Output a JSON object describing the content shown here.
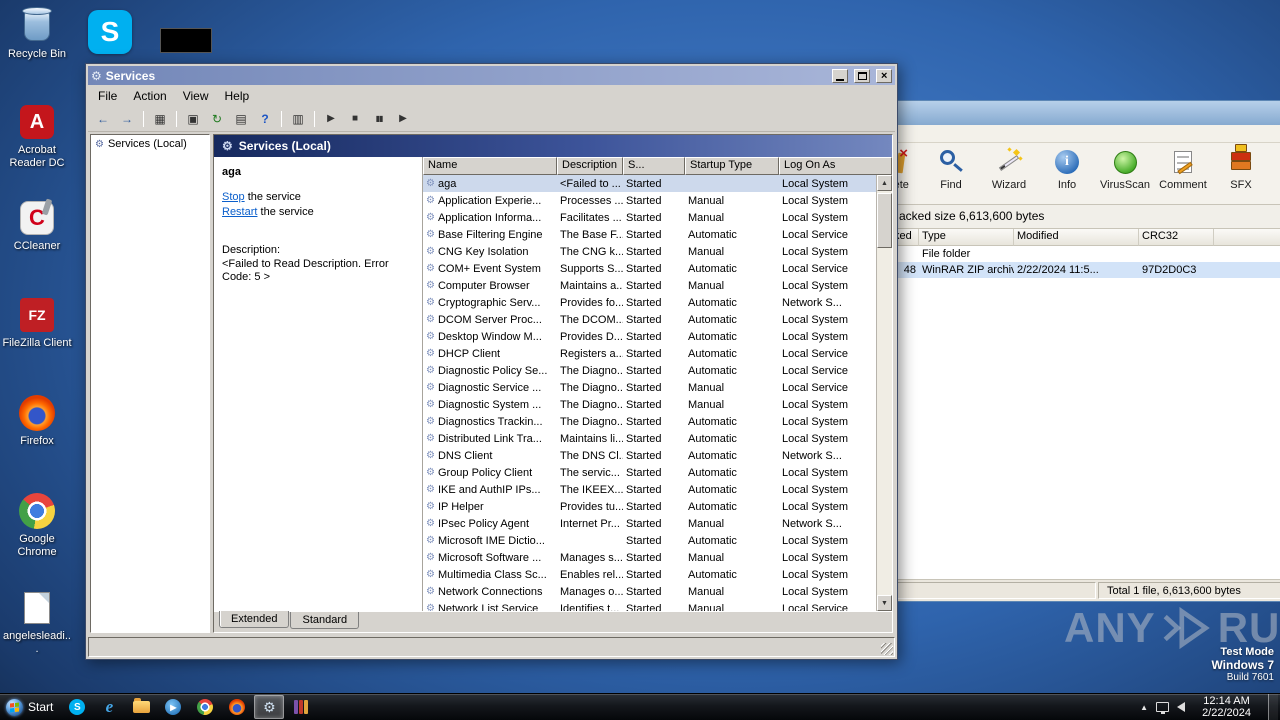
{
  "desktop": {
    "icons": [
      {
        "label": "Recycle Bin"
      },
      {
        "label": "Acrobat Reader DC"
      },
      {
        "label": "CCleaner"
      },
      {
        "label": "FileZilla Client"
      },
      {
        "label": "Firefox"
      },
      {
        "label": "Google Chrome"
      },
      {
        "label": "angelesleadi..."
      }
    ]
  },
  "icons": {
    "back": "←",
    "forward": "→",
    "tree": "▦",
    "window": "▣",
    "refresh": "↻",
    "export": "▤",
    "help": "?",
    "list": "▥",
    "start": "▶",
    "stop": "■",
    "pause": "▮▮",
    "restart": "▶",
    "gear": "⚙",
    "skype_letter": "S",
    "acrobat_letter": "A",
    "ccleaner_letter": "C",
    "filezilla_letters": "FZ",
    "ie_letter": "e",
    "wmp_glyph": "▶"
  },
  "services": {
    "title": "Services",
    "menu": [
      "File",
      "Action",
      "View",
      "Help"
    ],
    "tree_root": "Services (Local)",
    "band_title": "Services (Local)",
    "detail": {
      "service_name": "aga",
      "stop_link": "Stop",
      "stop_suffix": " the service",
      "restart_link": "Restart",
      "restart_suffix": " the service",
      "description_label": "Description:",
      "description": "<Failed to Read Description. Error Code: 5 >"
    },
    "columns": [
      "Name",
      "Description",
      "S...",
      "Startup Type",
      "Log On As"
    ],
    "rows": [
      [
        "aga",
        "<Failed to ...",
        "Started",
        "",
        "Local System"
      ],
      [
        "Application Experie...",
        "Processes ...",
        "Started",
        "Manual",
        "Local System"
      ],
      [
        "Application Informa...",
        "Facilitates ...",
        "Started",
        "Manual",
        "Local System"
      ],
      [
        "Base Filtering Engine",
        "The Base F...",
        "Started",
        "Automatic",
        "Local Service"
      ],
      [
        "CNG Key Isolation",
        "The CNG k...",
        "Started",
        "Manual",
        "Local System"
      ],
      [
        "COM+ Event System",
        "Supports S...",
        "Started",
        "Automatic",
        "Local Service"
      ],
      [
        "Computer Browser",
        "Maintains a...",
        "Started",
        "Manual",
        "Local System"
      ],
      [
        "Cryptographic Serv...",
        "Provides fo...",
        "Started",
        "Automatic",
        "Network S..."
      ],
      [
        "DCOM Server Proc...",
        "The DCOM...",
        "Started",
        "Automatic",
        "Local System"
      ],
      [
        "Desktop Window M...",
        "Provides D...",
        "Started",
        "Automatic",
        "Local System"
      ],
      [
        "DHCP Client",
        "Registers a...",
        "Started",
        "Automatic",
        "Local Service"
      ],
      [
        "Diagnostic Policy Se...",
        "The Diagno...",
        "Started",
        "Automatic",
        "Local Service"
      ],
      [
        "Diagnostic Service ...",
        "The Diagno...",
        "Started",
        "Manual",
        "Local Service"
      ],
      [
        "Diagnostic System ...",
        "The Diagno...",
        "Started",
        "Manual",
        "Local System"
      ],
      [
        "Diagnostics Trackin...",
        "The Diagno...",
        "Started",
        "Automatic",
        "Local System"
      ],
      [
        "Distributed Link Tra...",
        "Maintains li...",
        "Started",
        "Automatic",
        "Local System"
      ],
      [
        "DNS Client",
        "The DNS Cl...",
        "Started",
        "Automatic",
        "Network S..."
      ],
      [
        "Group Policy Client",
        "The servic...",
        "Started",
        "Automatic",
        "Local System"
      ],
      [
        "IKE and AuthIP IPs...",
        "The IKEEX...",
        "Started",
        "Automatic",
        "Local System"
      ],
      [
        "IP Helper",
        "Provides tu...",
        "Started",
        "Automatic",
        "Local System"
      ],
      [
        "IPsec Policy Agent",
        "Internet Pr...",
        "Started",
        "Manual",
        "Network S..."
      ],
      [
        "Microsoft IME Dictio...",
        "",
        "Started",
        "Automatic",
        "Local System"
      ],
      [
        "Microsoft Software ...",
        "Manages s...",
        "Started",
        "Manual",
        "Local System"
      ],
      [
        "Multimedia Class Sc...",
        "Enables rel...",
        "Started",
        "Automatic",
        "Local System"
      ],
      [
        "Network Connections",
        "Manages o...",
        "Started",
        "Manual",
        "Local System"
      ],
      [
        "Network List Service",
        "Identifies t...",
        "Started",
        "Manual",
        "Local Service"
      ]
    ],
    "tabs": [
      "Extended",
      "Standard"
    ]
  },
  "winrar": {
    "toolbar": [
      "Delete",
      "Find",
      "Wizard",
      "Info",
      "VirusScan",
      "Comment",
      "SFX"
    ],
    "info_bar": "acked size  6,613,600 bytes",
    "columns": [
      "Packed",
      "Type",
      "Modified",
      "CRC32"
    ],
    "rows": [
      [
        "",
        "File folder",
        "",
        ""
      ],
      [
        "48",
        "WinRAR ZIP archive",
        "2/22/2024 11:5...",
        "97D2D0C3"
      ]
    ],
    "status_total": "Total 1 file, 6,613,600 bytes"
  },
  "watermark": {
    "brand_left": "ANY",
    "brand_right": "RUN",
    "mode": "Test Mode",
    "os": "Windows 7",
    "build": "Build 7601"
  },
  "taskbar": {
    "start_label": "Start",
    "time": "12:14 AM",
    "date": "2/22/2024"
  },
  "colors": {
    "selection": "#cdd9ec",
    "band_dark": "#16295e",
    "link": "#0b5fcb",
    "taskbar_active": "#3b5773"
  }
}
